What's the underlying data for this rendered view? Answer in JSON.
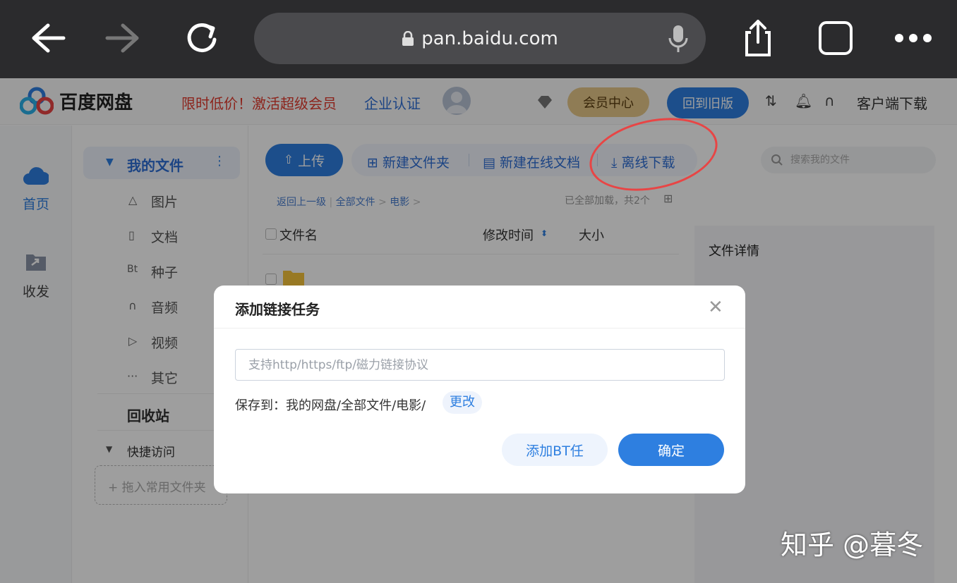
{
  "browser": {
    "url": "pan.baidu.com"
  },
  "header": {
    "logo_text": "百度网盘",
    "promo": "限时低价！激活超级会员",
    "enterprise": "企业认证",
    "vip_center": "会员中心",
    "back_to_old": "回到旧版",
    "client_download": "客户端下载"
  },
  "rail": {
    "home": "首页",
    "share": "收发"
  },
  "sidebar": {
    "my_files": "我的文件",
    "items": [
      {
        "label": "图片",
        "icon": "△"
      },
      {
        "label": "文档",
        "icon": "▯"
      },
      {
        "label": "种子",
        "icon": "Bt"
      },
      {
        "label": "音频",
        "icon": "∩"
      },
      {
        "label": "视频",
        "icon": "▷"
      },
      {
        "label": "其它",
        "icon": "···"
      }
    ],
    "recycle": "回收站",
    "quick_access": "快捷访问",
    "drop_hint": "+ 拖入常用文件夹"
  },
  "toolbar": {
    "upload": "上传",
    "new_folder": "新建文件夹",
    "new_doc": "新建在线文档",
    "offline_download": "离线下载",
    "search_placeholder": "搜索我的文件"
  },
  "breadcrumb": {
    "back": "返回上一级",
    "all_files": "全部文件",
    "current": "电影",
    "loaded": "已全部加载，共2个"
  },
  "columns": {
    "name": "文件名",
    "modified": "修改时间",
    "size": "大小"
  },
  "details": {
    "title": "文件详情"
  },
  "dialog": {
    "title": "添加链接任务",
    "input_placeholder": "支持http/https/ftp/磁力链接协议",
    "save_to": "保存到：我的网盘/全部文件/电影/",
    "change": "更改",
    "add_bt": "添加BT任",
    "confirm": "确定"
  },
  "watermark": "知乎 @暮冬"
}
